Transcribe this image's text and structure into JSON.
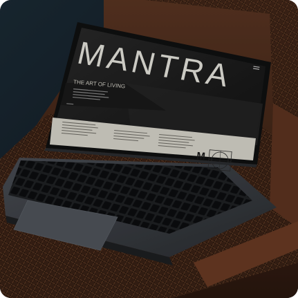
{
  "site": {
    "brand": "MANTRA",
    "tagline": "THE ART OF LIVING",
    "logo_mark": "M",
    "menu_icon": "hamburger-icon"
  },
  "colors": {
    "chair_wood": "#4a2c1c",
    "wall": "#16222c",
    "laptop_body": "#3e4248",
    "screen_dark": "#141414",
    "page_cream": "#d9d6cc"
  }
}
